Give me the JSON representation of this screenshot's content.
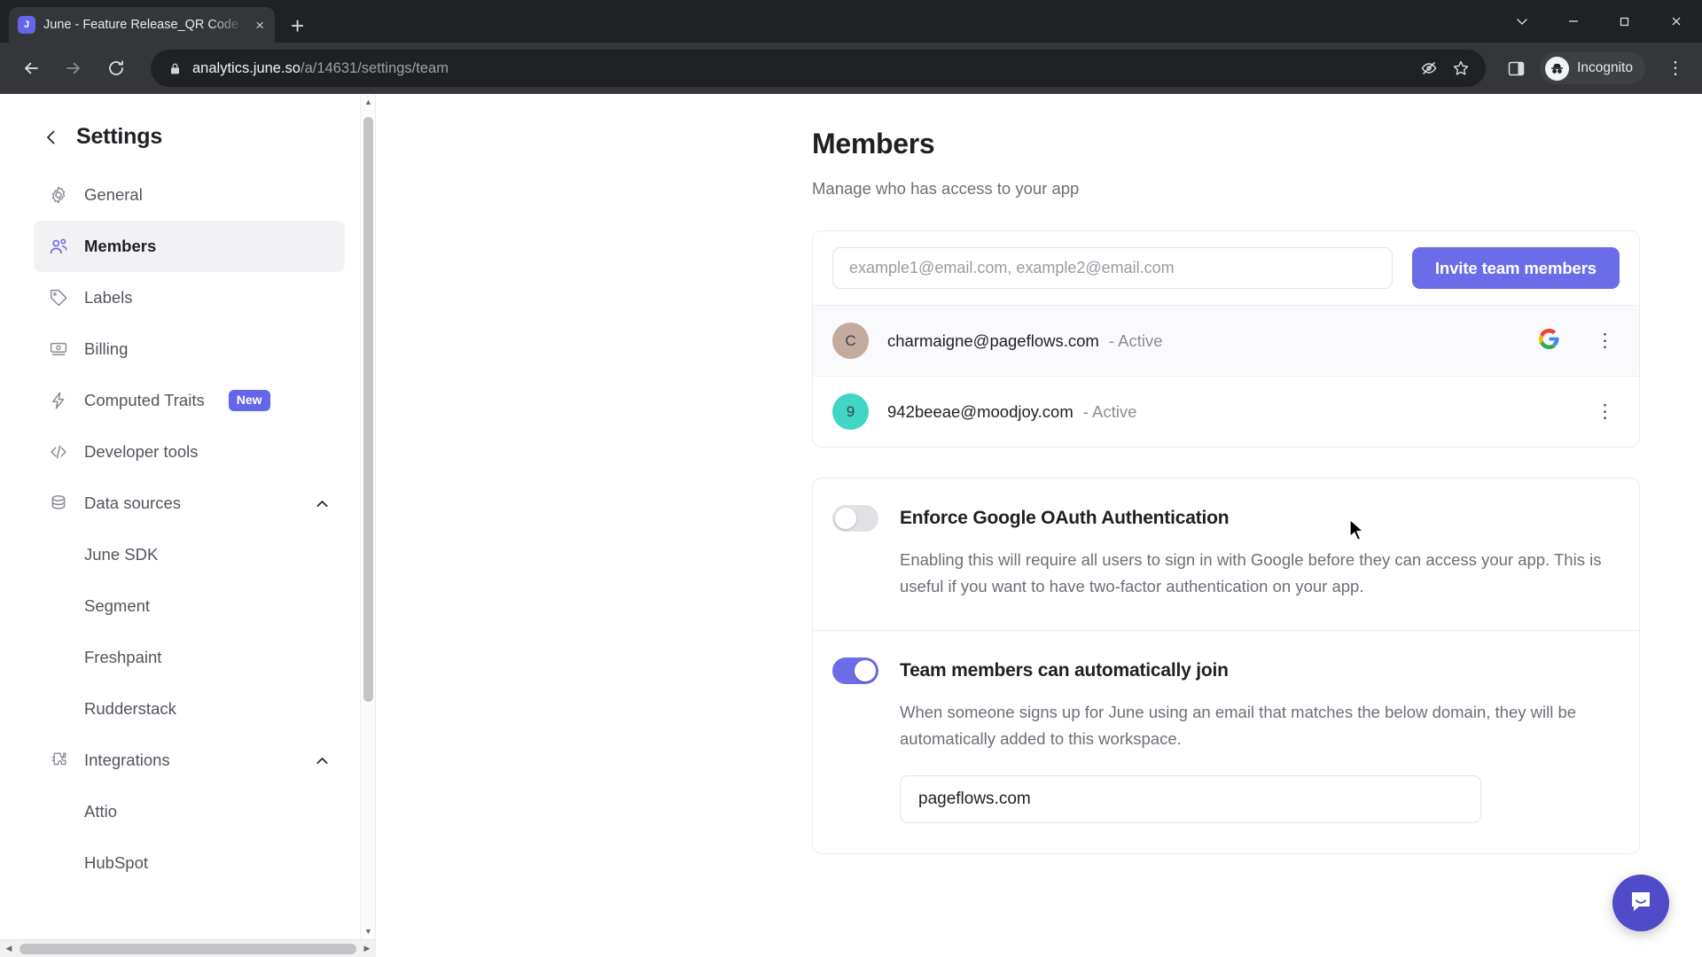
{
  "browser": {
    "tab": {
      "title": "June - Feature Release_QR Code",
      "favicon": "J",
      "close_label": "×"
    },
    "new_tab_label": "+",
    "window_controls": {
      "minimize": "—",
      "maximize": "❐",
      "close": "✕",
      "tab_search": "chevron-down-icon"
    },
    "omnibox": {
      "domain": "analytics.june.so",
      "path": "/a/14631/settings/team",
      "lock": "lock-icon"
    },
    "profile_label": "Incognito"
  },
  "sidebar": {
    "title": "Settings",
    "items": [
      {
        "label": "General",
        "icon": "gear-icon",
        "active": false
      },
      {
        "label": "Members",
        "icon": "users-icon",
        "active": true
      },
      {
        "label": "Labels",
        "icon": "tag-icon",
        "active": false
      },
      {
        "label": "Billing",
        "icon": "card-icon",
        "active": false
      },
      {
        "label": "Computed Traits",
        "icon": "bolt-icon",
        "active": false,
        "badge": "New"
      },
      {
        "label": "Developer tools",
        "icon": "code-icon",
        "active": false
      }
    ],
    "groups": [
      {
        "label": "Data sources",
        "icon": "database-icon",
        "expanded": true,
        "children": [
          "June SDK",
          "Segment",
          "Freshpaint",
          "Rudderstack"
        ]
      },
      {
        "label": "Integrations",
        "icon": "puzzle-icon",
        "expanded": true,
        "children": [
          "Attio",
          "HubSpot"
        ]
      }
    ]
  },
  "main": {
    "title": "Members",
    "subtitle": "Manage who has access to your app",
    "invite": {
      "placeholder": "example1@email.com, example2@email.com",
      "value": "",
      "button_label": "Invite team members"
    },
    "members": [
      {
        "avatar_letter": "C",
        "avatar_color": "#c3ab9e",
        "email": "charmaigne@pageflows.com",
        "status": "- Active",
        "provider": "google"
      },
      {
        "avatar_letter": "9",
        "avatar_color": "#3fd6c4",
        "email": "942beeae@moodjoy.com",
        "status": "- Active",
        "provider": ""
      }
    ],
    "settings": [
      {
        "title": "Enforce Google OAuth Authentication",
        "enabled": false,
        "description": "Enabling this will require all users to sign in with Google before they can access your app. This is useful if you want to have two-factor authentication on your app."
      },
      {
        "title": "Team members can automatically join",
        "enabled": true,
        "description": "When someone signs up for June using an email that matches the below domain, they will be automatically added to this workspace.",
        "domain_value": "pageflows.com"
      }
    ]
  },
  "widgets": {
    "intercom_label": "intercom-chat-icon"
  },
  "colors": {
    "accent": "#6b6ce8",
    "badge": "#6366e8",
    "chrome_dark": "#35363a",
    "tabstrip": "#202124"
  }
}
